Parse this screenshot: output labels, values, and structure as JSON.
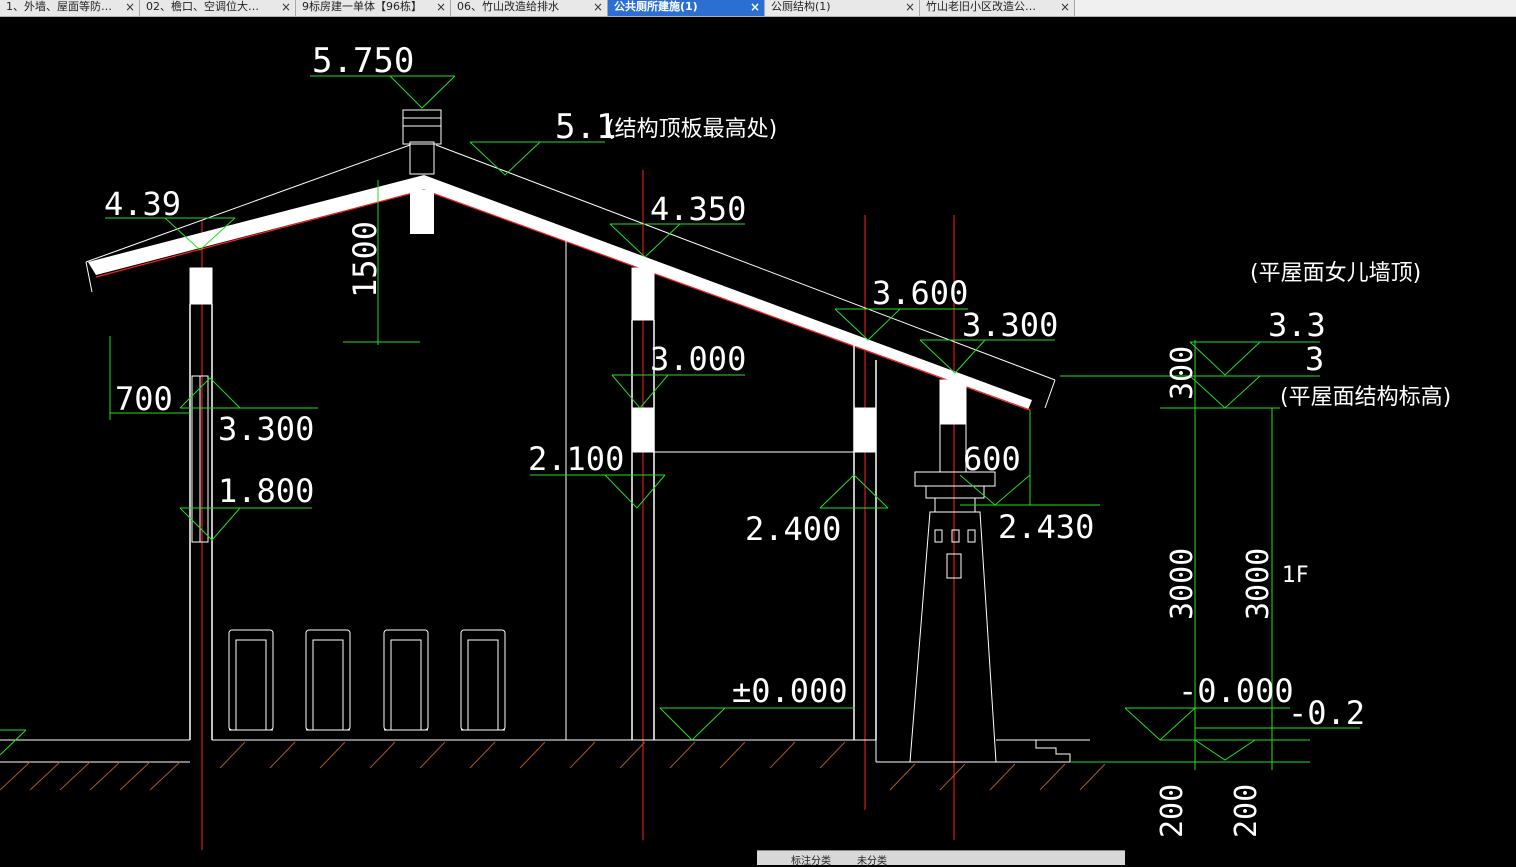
{
  "tabs": [
    {
      "label": "1、外墙、屋面等防…",
      "width": 140,
      "active": false
    },
    {
      "label": "02、檐口、空调位大…",
      "width": 156,
      "active": false
    },
    {
      "label": "9标房建一单体【96栋】",
      "width": 155,
      "active": false
    },
    {
      "label": "06、竹山改造给排水",
      "width": 157,
      "active": false
    },
    {
      "label": "公共厕所建施(1)",
      "width": 157,
      "active": true
    },
    {
      "label": "公厕结构(1)",
      "width": 155,
      "active": false
    },
    {
      "label": "竹山老旧小区改造公…",
      "width": 155,
      "active": false
    }
  ],
  "close_glyph": "×",
  "colors": {
    "background": "#000000",
    "wall": "#ffffff",
    "dimension": "#00ff00",
    "axis": "#ff0000",
    "active_tab": "#2a6fd1"
  },
  "annotations": {
    "elev_5750": "5.750",
    "elev_51": "5.1",
    "elev_51_note": "(结构顶板最高处)",
    "elev_439": "4.39",
    "elev_4350": "4.350",
    "dim_1500": "1500",
    "elev_3600": "3.600",
    "elev_3300_right": "3.300",
    "note_parapet": "(平屋面女儿墙顶)",
    "elev_33": "3.3",
    "elev_3": "3",
    "dim_300": "300",
    "note_flat_roof": "(平屋面结构标高)",
    "elev_3000": "3.000",
    "dim_700": "700",
    "elev_3300_left": "3.300",
    "elev_2100": "2.100",
    "dim_600": "600",
    "elev_1800": "1.800",
    "elev_2400": "2.400",
    "elev_2430": "2.430",
    "dim_3000_a": "3000",
    "dim_3000_b": "3000",
    "floor_1f": "1F",
    "elev_pm0": "±0.000",
    "elev_m0": "-0.000",
    "elev_m02": "-0.2",
    "dim_200_a": "200",
    "dim_200_b": "200"
  },
  "statusbar": {
    "item1": "标注分类",
    "item2": "未分类"
  }
}
